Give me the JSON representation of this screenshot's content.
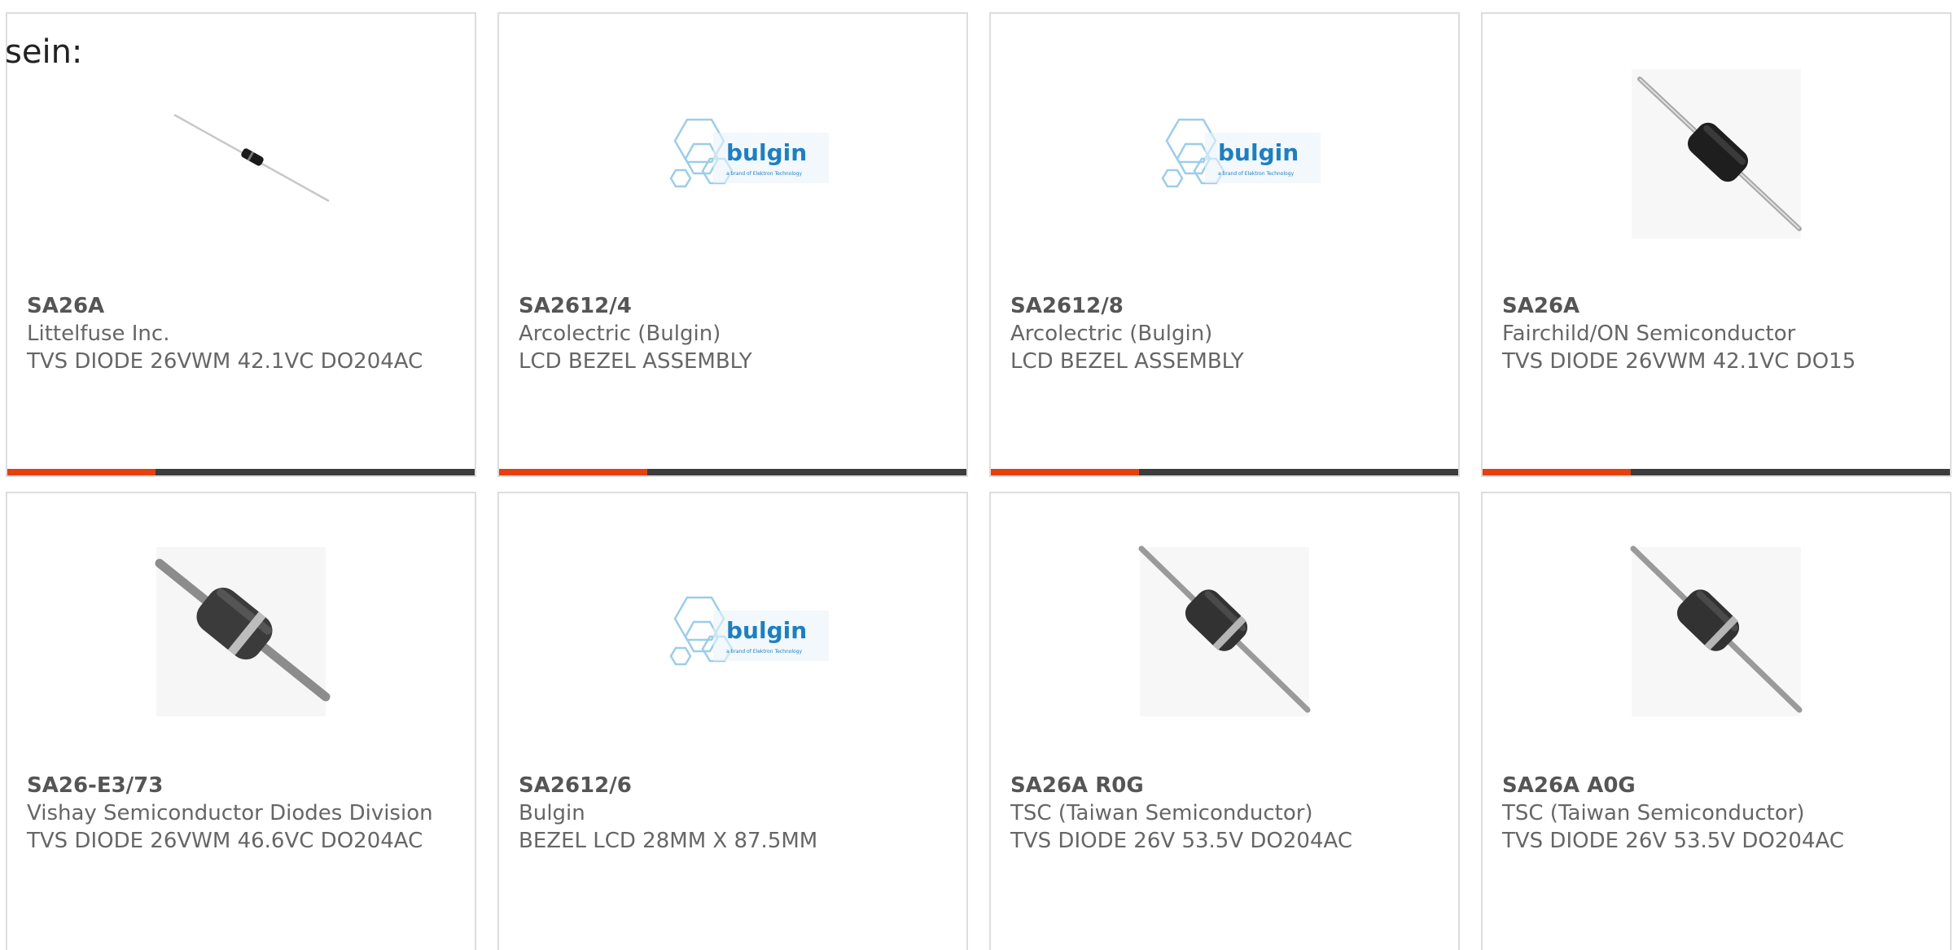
{
  "intro_text": "sein:",
  "colors": {
    "accent": "#e5400e",
    "bar_dark": "#3c3c3c",
    "card_border": "#dddddd",
    "text_gray": "#666666",
    "bulgin_blue": "#1e7fc0",
    "bulgin_light": "#9ccde8"
  },
  "products": [
    {
      "part_number": "SA26A",
      "manufacturer": "Littelfuse Inc.",
      "description": "TVS DIODE 26VWM 42.1VC DO204AC",
      "image": "thin-axial-diode-image"
    },
    {
      "part_number": "SA2612/4",
      "manufacturer": "Arcolectric (Bulgin)",
      "description": "LCD BEZEL ASSEMBLY",
      "image": "bulgin-logo-image",
      "logo_text": "bulgin",
      "logo_subtext": "a brand of Elektron Technology"
    },
    {
      "part_number": "SA2612/8",
      "manufacturer": "Arcolectric (Bulgin)",
      "description": "LCD BEZEL ASSEMBLY",
      "image": "bulgin-logo-image",
      "logo_text": "bulgin",
      "logo_subtext": "a brand of Elektron Technology"
    },
    {
      "part_number": "SA26A",
      "manufacturer": "Fairchild/ON Semiconductor",
      "description": "TVS DIODE 26VWM 42.1VC DO15",
      "image": "axial-diode-image"
    },
    {
      "part_number": "SA26-E3/73",
      "manufacturer": "Vishay Semiconductor Diodes Division",
      "description": "TVS DIODE 26VWM 46.6VC DO204AC",
      "image": "axial-diode-image"
    },
    {
      "part_number": "SA2612/6",
      "manufacturer": "Bulgin",
      "description": "BEZEL LCD 28MM X 87.5MM",
      "image": "bulgin-logo-image",
      "logo_text": "bulgin",
      "logo_subtext": "a brand of Elektron Technology"
    },
    {
      "part_number": "SA26A R0G",
      "manufacturer": "TSC (Taiwan Semiconductor)",
      "description": "TVS DIODE 26V 53.5V DO204AC",
      "image": "axial-diode-image"
    },
    {
      "part_number": "SA26A A0G",
      "manufacturer": "TSC (Taiwan Semiconductor)",
      "description": "TVS DIODE 26V 53.5V DO204AC",
      "image": "axial-diode-image"
    }
  ]
}
